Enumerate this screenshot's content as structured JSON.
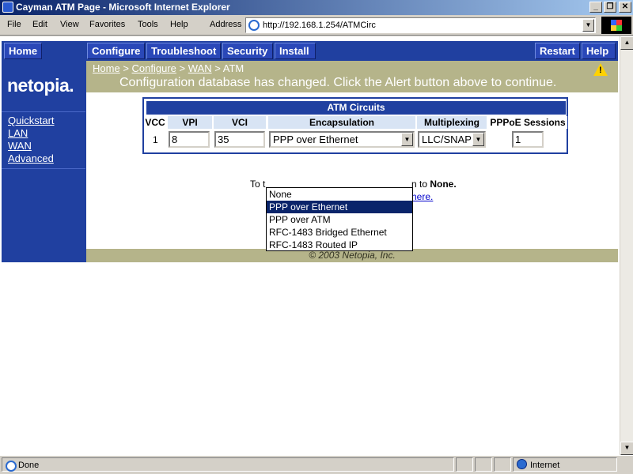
{
  "window": {
    "title": "Cayman ATM Page - Microsoft Internet Explorer"
  },
  "menu": [
    "File",
    "Edit",
    "View",
    "Favorites",
    "Tools",
    "Help"
  ],
  "address": {
    "label": "Address",
    "url": "http://192.168.1.254/ATMCirc"
  },
  "nav": {
    "home": "Home",
    "configure": "Configure",
    "troubleshoot": "Troubleshoot",
    "security": "Security",
    "install": "Install",
    "restart": "Restart",
    "help": "Help"
  },
  "brand": {
    "logo": "netopia."
  },
  "sidebar": {
    "items": [
      "Quickstart",
      "LAN",
      "WAN",
      "Advanced"
    ]
  },
  "breadcrumb": {
    "home": "Home",
    "configure": "Configure",
    "wan": "WAN",
    "current": "ATM",
    "sep": ">"
  },
  "alert": {
    "message": "Configuration database has changed. Click the Alert button above to continue."
  },
  "atm_table": {
    "title": "ATM Circuits",
    "headers": [
      "VCC",
      "VPI",
      "VCI",
      "Encapsulation",
      "Multiplexing",
      "PPPoE Sessions"
    ],
    "row": {
      "vcc": "1",
      "vpi": "8",
      "vci": "35",
      "encapsulation": "PPP over Ethernet",
      "multiplexing": "LLC/SNAP",
      "pppoe_sessions": "1"
    }
  },
  "encapsulation_options": [
    "None",
    "PPP over Ethernet",
    "PPP over ATM",
    "RFC-1483 Bridged Ethernet",
    "RFC-1483 Routed IP"
  ],
  "selected_option_index": 1,
  "notes": {
    "prefix": "To t",
    "suffix_a": "n to ",
    "suffix_bold": "None.",
    "link": "here."
  },
  "footer": {
    "copyright": "© 2003 Netopia, Inc."
  },
  "statusbar": {
    "status": "Done",
    "zone": "Internet"
  }
}
